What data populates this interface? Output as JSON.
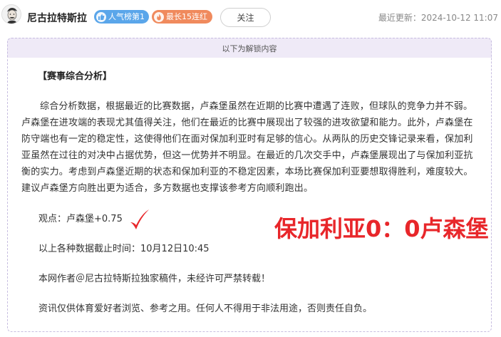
{
  "header": {
    "author": "尼古拉特斯拉",
    "badge_popularity": "人气榜第1",
    "badge_streak": "最长15连红",
    "follow_label": "关注",
    "updated_text": "最近更新：2024-10-12 11:07"
  },
  "unlock": {
    "notice": "以下为解锁内容"
  },
  "article": {
    "section_title": "【赛事综合分析】",
    "paragraph": "综合分析数据，根据最近的比赛数据，卢森堡虽然在近期的比赛中遭遇了连败，但球队的竞争力并不弱。卢森堡在进攻端的表现尤其值得关注，他们在最近的比赛中展现出了较强的进攻欲望和能力。此外，卢森堡在防守端也有一定的稳定性，这使得他们在面对保加利亚时有足够的信心。从两队的历史交锋记录来看，保加利亚虽然在过往的对决中占据优势，但这一优势并不明显。在最近的几次交手中，卢森堡展现出了与保加利亚抗衡的实力。考虑到卢森堡近期的状态和保加利亚的不稳定因素，本场比赛保加利亚要想取得胜利，难度较大。建议卢森堡方向胜出更为适合，多方数据也支撑该参考方向顺利跑出。",
    "viewpoint": "观点：卢森堡+0.75",
    "cutoff": "以上各种数据截止时间：10月12日10:45",
    "copyright": "本网作者＠尼古拉特斯拉独家稿件，未经许可严禁转载！",
    "disclaimer": "资讯仅供体育爱好者浏览、参考之用。任何人不得用于非法用途，否则责任自负。"
  },
  "result": {
    "score_text": "保加利亚0：0卢森堡",
    "score_color": "#e8262a"
  },
  "colors": {
    "badge_blue": "#5aa6ea",
    "badge_orange": "#f08a5d",
    "unlock_bg": "#efeaf7"
  },
  "icons": {
    "avatar": "portrait-avatar",
    "popularity": "thumb-icon",
    "streak": "flame-icon",
    "check": "red-checkmark-icon"
  }
}
